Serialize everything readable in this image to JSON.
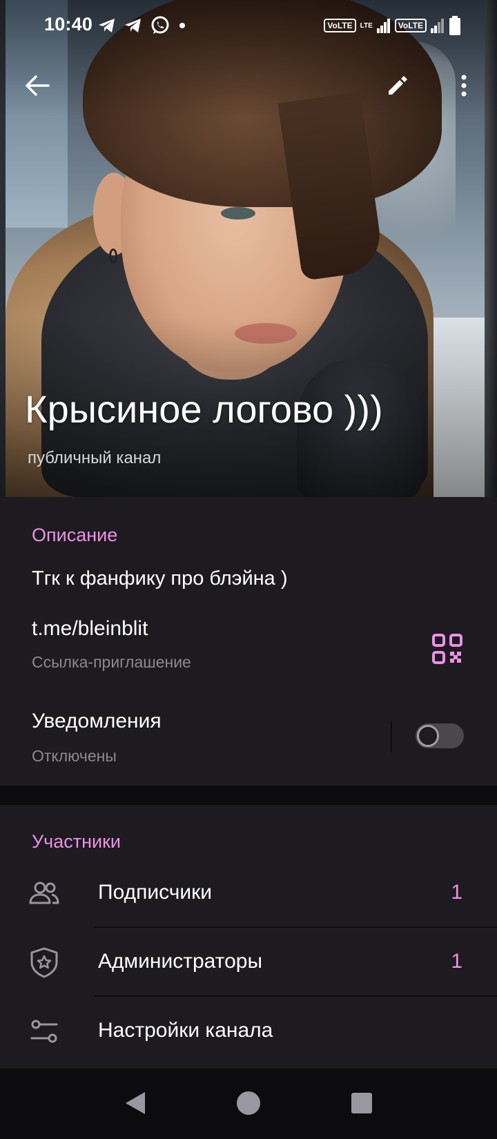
{
  "status_bar": {
    "time": "10:40",
    "left_icons": [
      "telegram-icon",
      "telegram-icon",
      "whatsapp-icon",
      "dot-icon"
    ],
    "volte_label": "VoLTE",
    "lte_label": "LTE"
  },
  "header": {
    "back_icon": "arrow-left-icon",
    "edit_icon": "pencil-icon",
    "more_icon": "more-vertical-icon",
    "title": "Крысиное логово )))",
    "subtitle": "публичный канал"
  },
  "info": {
    "section_title": "Описание",
    "description": "Тгк к фанфику про блэйна )",
    "link": "t.me/bleinblit",
    "link_caption": "Ссылка-приглашение",
    "notifications_label": "Уведомления",
    "notifications_status": "Отключены",
    "notifications_enabled": false
  },
  "members": {
    "section_title": "Участники",
    "items": [
      {
        "label": "Подписчики",
        "count": "1",
        "icon": "people-icon"
      },
      {
        "label": "Администраторы",
        "count": "1",
        "icon": "shield-star-icon"
      },
      {
        "label": "Настройки канала",
        "count": "",
        "icon": "sliders-icon"
      }
    ]
  },
  "colors": {
    "accent": "#ee8fe9",
    "card_bg": "#1d1b1f",
    "page_bg": "#0c0b0d",
    "secondary_text": "#8c8990"
  }
}
